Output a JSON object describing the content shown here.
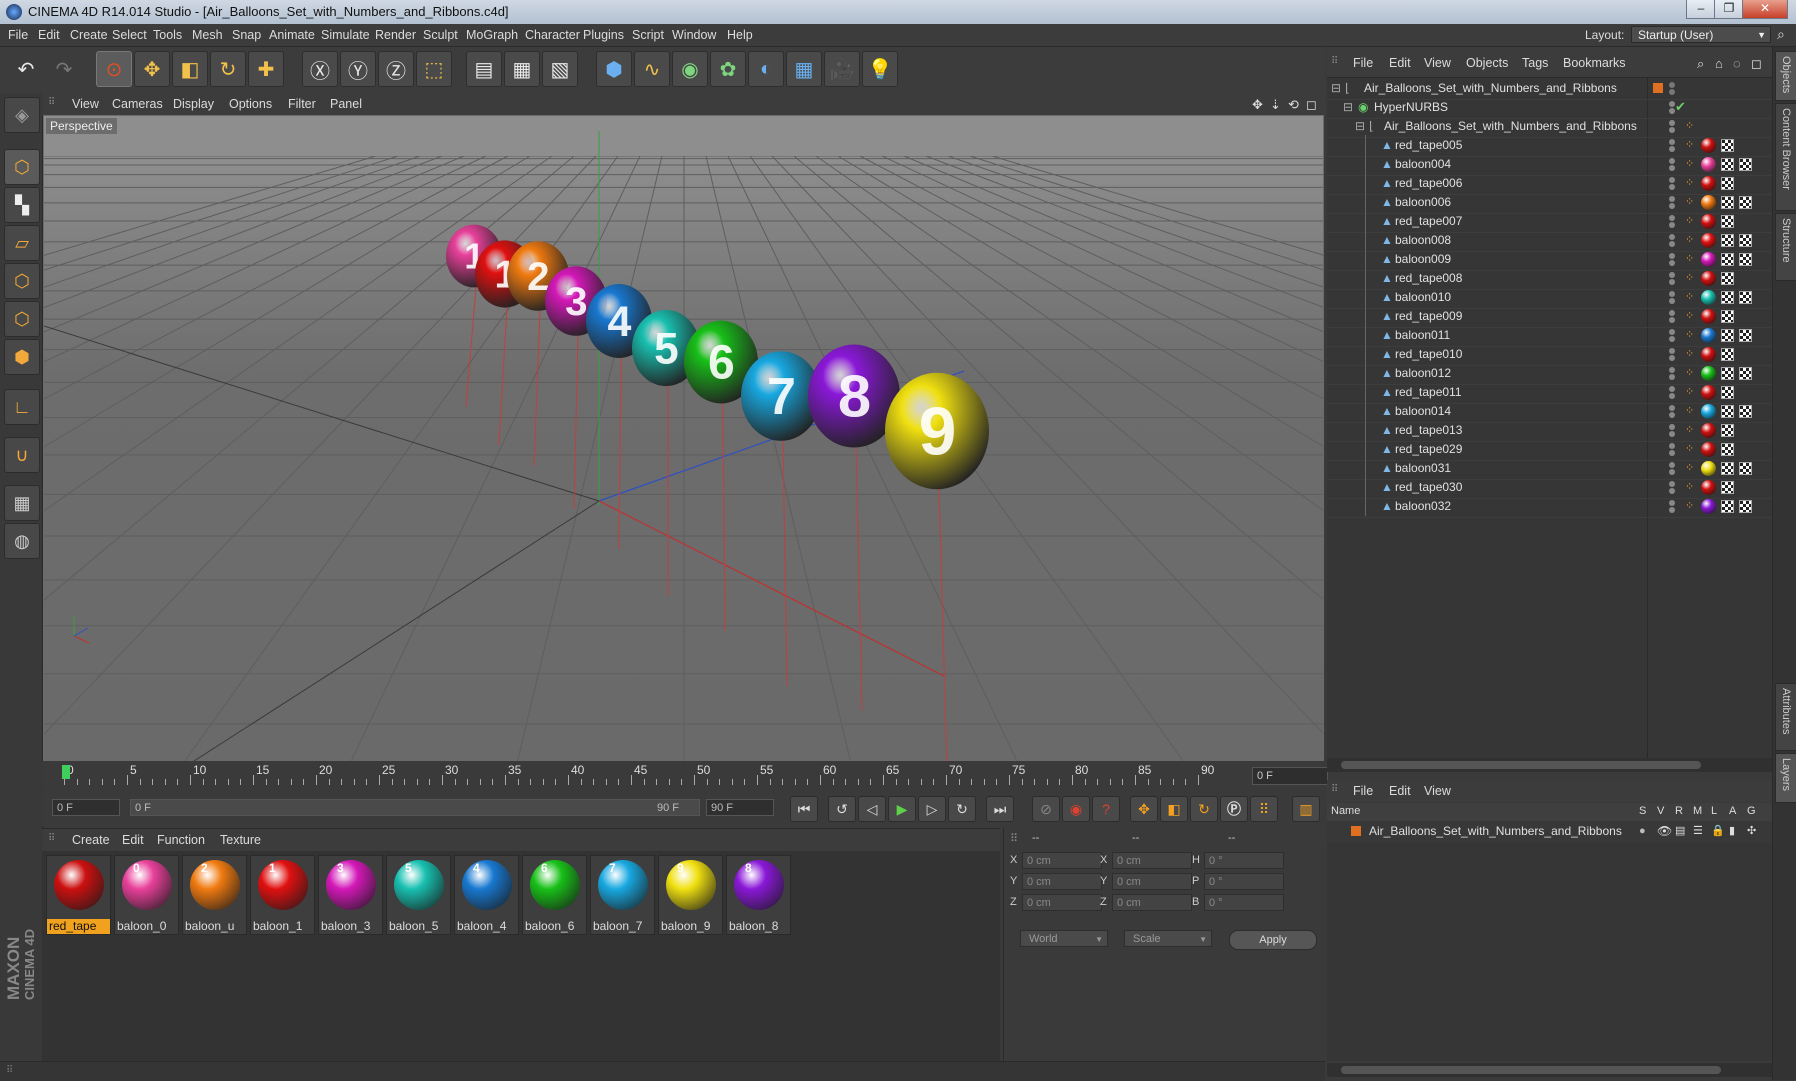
{
  "window": {
    "title": "CINEMA 4D R14.014 Studio - [Air_Balloons_Set_with_Numbers_and_Ribbons.c4d]",
    "controls": [
      "–",
      "❐",
      "✕"
    ]
  },
  "menubar": [
    "File",
    "Edit",
    "Create",
    "Select",
    "Tools",
    "Mesh",
    "Snap",
    "Animate",
    "Simulate",
    "Render",
    "Sculpt",
    "MoGraph",
    "Character",
    "Plugins",
    "Script",
    "Window",
    "Help"
  ],
  "layout": {
    "label": "Layout:",
    "value": "Startup (User)"
  },
  "viewport": {
    "menu": [
      "View",
      "Cameras",
      "Display",
      "Options",
      "Filter",
      "Panel"
    ],
    "camera_label": "Perspective",
    "balloons": [
      {
        "number": "1",
        "color": "#e8409a"
      },
      {
        "number": "1",
        "color": "#e01010"
      },
      {
        "number": "2",
        "color": "#f07a10"
      },
      {
        "number": "3",
        "color": "#d418b8"
      },
      {
        "number": "4",
        "color": "#1878d0"
      },
      {
        "number": "5",
        "color": "#18c0b0"
      },
      {
        "number": "6",
        "color": "#18c018"
      },
      {
        "number": "7",
        "color": "#18a8e0"
      },
      {
        "number": "8",
        "color": "#8a18d8"
      },
      {
        "number": "9",
        "color": "#f0e010"
      }
    ]
  },
  "timeline": {
    "labels": [
      "0",
      "5",
      "10",
      "15",
      "20",
      "25",
      "30",
      "35",
      "40",
      "45",
      "50",
      "55",
      "60",
      "65",
      "70",
      "75",
      "80",
      "85",
      "90"
    ],
    "current_frame": "0 F"
  },
  "transport": {
    "start_field": "0 F",
    "range_start": "0 F",
    "range_end": "90 F",
    "end_field": "90 F"
  },
  "materials": {
    "menu": [
      "Create",
      "Edit",
      "Function",
      "Texture"
    ],
    "items": [
      {
        "label": "red_tape",
        "color": "#cc1010",
        "num": "",
        "selected": true
      },
      {
        "label": "baloon_0",
        "color": "#e8409a",
        "num": "0",
        "selected": false
      },
      {
        "label": "baloon_u",
        "color": "#f07a10",
        "num": "2",
        "selected": false
      },
      {
        "label": "baloon_1",
        "color": "#e01010",
        "num": "1",
        "selected": false
      },
      {
        "label": "baloon_3",
        "color": "#d418b8",
        "num": "3",
        "selected": false
      },
      {
        "label": "baloon_5",
        "color": "#18c0b0",
        "num": "5",
        "selected": false
      },
      {
        "label": "baloon_4",
        "color": "#1878d0",
        "num": "4",
        "selected": false
      },
      {
        "label": "baloon_6",
        "color": "#18c018",
        "num": "6",
        "selected": false
      },
      {
        "label": "baloon_7",
        "color": "#18a8e0",
        "num": "7",
        "selected": false
      },
      {
        "label": "baloon_9",
        "color": "#f0e010",
        "num": "9",
        "selected": false
      },
      {
        "label": "baloon_8",
        "color": "#8a18d8",
        "num": "8",
        "selected": false
      }
    ]
  },
  "coords": {
    "headers": [
      "--",
      "--",
      "--"
    ],
    "rows": [
      {
        "a": "X",
        "av": "0 cm",
        "b": "X",
        "bv": "0 cm",
        "c": "H",
        "cv": "0 °"
      },
      {
        "a": "Y",
        "av": "0 cm",
        "b": "Y",
        "bv": "0 cm",
        "c": "P",
        "cv": "0 °"
      },
      {
        "a": "Z",
        "av": "0 cm",
        "b": "Z",
        "bv": "0 cm",
        "c": "B",
        "cv": "0 °"
      }
    ],
    "space": "World",
    "mode": "Scale",
    "apply": "Apply"
  },
  "objects": {
    "menu": [
      "File",
      "Edit",
      "View",
      "Objects",
      "Tags",
      "Bookmarks"
    ],
    "root": "Air_Balloons_Set_with_Numbers_and_Ribbons",
    "hypernurbs": "HyperNURBS",
    "group": "Air_Balloons_Set_with_Numbers_and_Ribbons",
    "items": [
      {
        "name": "red_tape005",
        "color": "#d01010",
        "balloon": false
      },
      {
        "name": "baloon004",
        "color": "#e8409a",
        "balloon": true
      },
      {
        "name": "red_tape006",
        "color": "#d01010",
        "balloon": false
      },
      {
        "name": "baloon006",
        "color": "#f07a10",
        "balloon": true
      },
      {
        "name": "red_tape007",
        "color": "#d01010",
        "balloon": false
      },
      {
        "name": "baloon008",
        "color": "#e01010",
        "balloon": true
      },
      {
        "name": "baloon009",
        "color": "#d418b8",
        "balloon": true
      },
      {
        "name": "red_tape008",
        "color": "#d01010",
        "balloon": false
      },
      {
        "name": "baloon010",
        "color": "#18c0b0",
        "balloon": true
      },
      {
        "name": "red_tape009",
        "color": "#d01010",
        "balloon": false
      },
      {
        "name": "baloon011",
        "color": "#1878d0",
        "balloon": true
      },
      {
        "name": "red_tape010",
        "color": "#d01010",
        "balloon": false
      },
      {
        "name": "baloon012",
        "color": "#18c018",
        "balloon": true
      },
      {
        "name": "red_tape011",
        "color": "#d01010",
        "balloon": false
      },
      {
        "name": "baloon014",
        "color": "#18a8e0",
        "balloon": true
      },
      {
        "name": "red_tape013",
        "color": "#d01010",
        "balloon": false
      },
      {
        "name": "red_tape029",
        "color": "#d01010",
        "balloon": false
      },
      {
        "name": "baloon031",
        "color": "#f0e010",
        "balloon": true
      },
      {
        "name": "red_tape030",
        "color": "#d01010",
        "balloon": false
      },
      {
        "name": "baloon032",
        "color": "#8a18d8",
        "balloon": true
      }
    ]
  },
  "layers": {
    "menu": [
      "File",
      "Edit",
      "View"
    ],
    "columns": [
      "Name",
      "S",
      "V",
      "R",
      "M",
      "L",
      "A",
      "G"
    ],
    "row": "Air_Balloons_Set_with_Numbers_and_Ribbons"
  },
  "sidetabs": [
    "Objects",
    "Content Browser",
    "Structure",
    "Attributes",
    "Layers"
  ],
  "logo": [
    "MAXON",
    "CINEMA 4D"
  ]
}
